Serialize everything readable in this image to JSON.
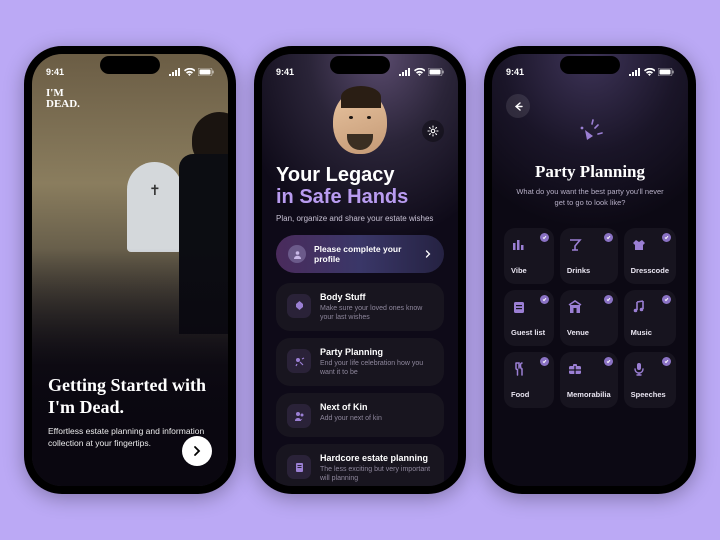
{
  "status": {
    "time": "9:41"
  },
  "screen1": {
    "logo_line1": "I'M",
    "logo_line2": "DEAD.",
    "title": "Getting Started with I'm Dead.",
    "subtitle": "Effortless estate planning and information collection at your fingertips."
  },
  "screen2": {
    "title_line1": "Your Legacy",
    "title_line2": "in Safe Hands",
    "subtitle": "Plan, organize and share your estate wishes",
    "cta": "Please complete your profile",
    "cards": [
      {
        "title": "Body Stuff",
        "subtitle": "Make sure your loved ones know your last wishes"
      },
      {
        "title": "Party Planning",
        "subtitle": "End your life celebration how you want it to be"
      },
      {
        "title": "Next of Kin",
        "subtitle": "Add your next of kin"
      },
      {
        "title": "Hardcore estate planning",
        "subtitle": "The less exciting but very important will planning"
      }
    ]
  },
  "screen3": {
    "title": "Party Planning",
    "subtitle": "What do you want the best party you'll never get to go to look like?",
    "tiles": [
      {
        "label": "Vibe",
        "checked": true
      },
      {
        "label": "Drinks",
        "checked": true
      },
      {
        "label": "Dresscode",
        "checked": true
      },
      {
        "label": "Guest list",
        "checked": true
      },
      {
        "label": "Venue",
        "checked": true
      },
      {
        "label": "Music",
        "checked": true
      },
      {
        "label": "Food",
        "checked": true
      },
      {
        "label": "Memorabilia",
        "checked": true
      },
      {
        "label": "Speeches",
        "checked": true
      }
    ]
  }
}
